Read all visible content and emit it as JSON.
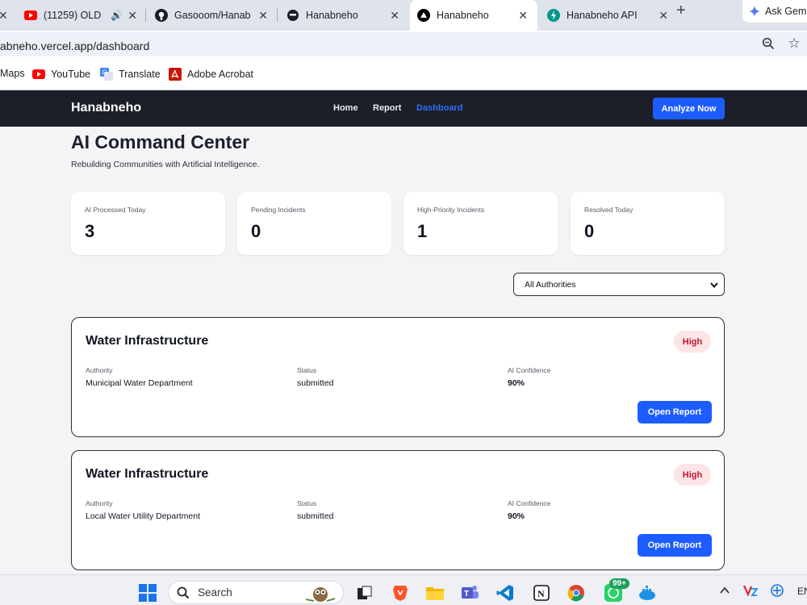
{
  "browser": {
    "tabs": [
      {
        "title": "(11259) OLD",
        "icon": "youtube-icon"
      },
      {
        "title": "Gasooom/Hanab",
        "icon": "github-icon"
      },
      {
        "title": "Hanabneho",
        "icon": "circle-logo-icon"
      },
      {
        "title": "Hanabneho",
        "icon": "vercel-icon",
        "active": true
      },
      {
        "title": "Hanabneho API",
        "icon": "fastapi-icon"
      }
    ],
    "ask_gemini": "Ask Gem",
    "url": "abneho.vercel.app/dashboard",
    "bookmarks": [
      {
        "label": "Maps"
      },
      {
        "label": "YouTube",
        "icon": "youtube-icon"
      },
      {
        "label": "Translate",
        "icon": "translate-icon"
      },
      {
        "label": "Adobe Acrobat",
        "icon": "acrobat-icon"
      }
    ]
  },
  "app": {
    "brand": "Hanabneho",
    "nav": [
      "Home",
      "Report",
      "Dashboard"
    ],
    "active_nav": "Dashboard",
    "cta": "Analyze Now",
    "accent": "#1d5cff"
  },
  "dashboard": {
    "title": "AI Command Center",
    "subtitle": "Rebuilding Communities with Artificial Intelligence.",
    "stats": [
      {
        "label": "AI Processed Today",
        "value": "3"
      },
      {
        "label": "Pending Incidents",
        "value": "0"
      },
      {
        "label": "High-Priority Incidents",
        "value": "1"
      },
      {
        "label": "Resolved Today",
        "value": "0"
      }
    ],
    "filter": {
      "selected": "All Authorities"
    },
    "field_labels": {
      "authority": "Authority",
      "status": "Status",
      "confidence": "AI Confidence"
    },
    "open_label": "Open Report",
    "incidents": [
      {
        "title": "Water Infrastructure",
        "priority": "High",
        "authority": "Municipal Water Department",
        "status": "submitted",
        "confidence": "90%"
      },
      {
        "title": "Water Infrastructure",
        "priority": "High",
        "authority": "Local Water Utility Department",
        "status": "submitted",
        "confidence": "90%"
      }
    ]
  },
  "taskbar": {
    "search": "Search",
    "badge": "99+",
    "tray_lang": "EN"
  }
}
